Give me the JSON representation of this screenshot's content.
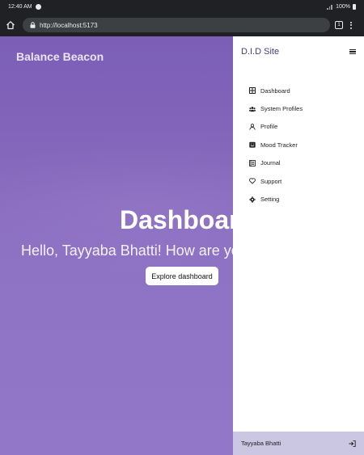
{
  "status_bar": {
    "time": "12:40 AM",
    "battery": "100%"
  },
  "browser": {
    "url": "http://localhost:5173",
    "tab_count": "1"
  },
  "site": {
    "brand": "Balance Beacon"
  },
  "hero": {
    "title": "Dashboard",
    "greeting": "Hello, Tayyaba Bhatti! How are you",
    "button_label": "Explore dashboard"
  },
  "drawer": {
    "title": "D.I.D Site",
    "items": [
      {
        "label": "Dashboard",
        "icon": "grid-icon"
      },
      {
        "label": "System Profiles",
        "icon": "users-icon"
      },
      {
        "label": "Profile",
        "icon": "user-icon"
      },
      {
        "label": "Mood Tracker",
        "icon": "mood-icon"
      },
      {
        "label": "Journal",
        "icon": "journal-icon"
      },
      {
        "label": "Support",
        "icon": "heart-icon"
      },
      {
        "label": "Setting",
        "icon": "gear-icon"
      }
    ],
    "footer_user": "Tayyaba Bhatti"
  },
  "colors": {
    "accent": "#7b5eb6",
    "drawer_footer": "#cbc7e2",
    "drawer_title": "#4a3d7a"
  }
}
